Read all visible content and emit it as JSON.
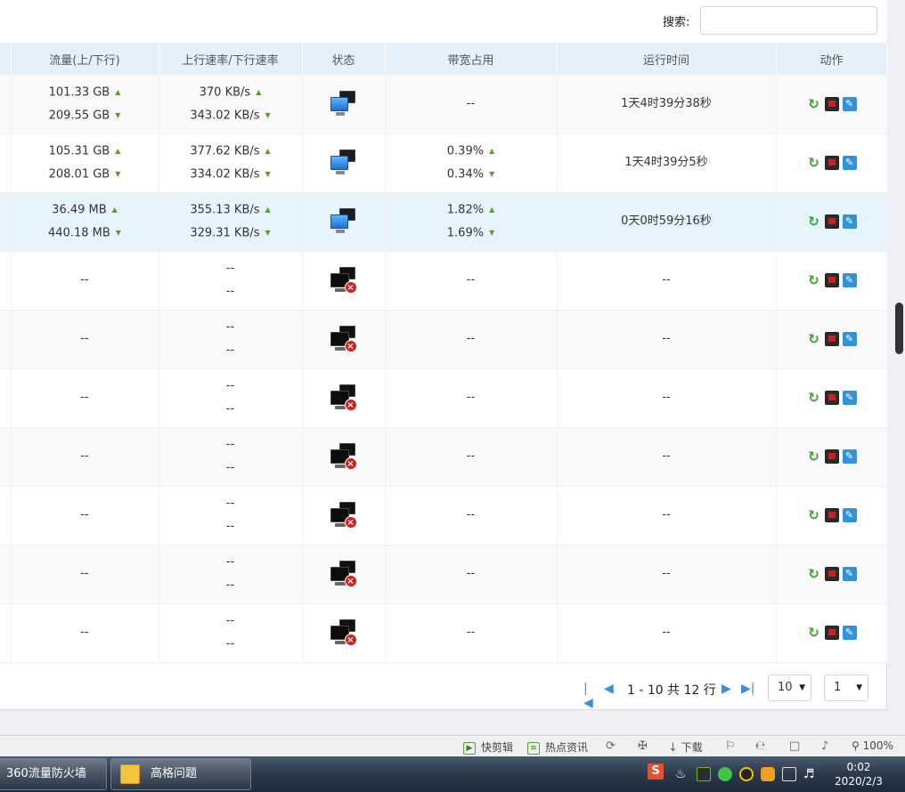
{
  "search": {
    "label": "搜索:",
    "value": ""
  },
  "columns": [
    "流量(上/下行)",
    "上行速率/下行速率",
    "状态",
    "带宽占用",
    "运行时间",
    "动作"
  ],
  "rows": [
    {
      "traffic_up": "101.33 GB",
      "traffic_down": "209.55 GB",
      "rate_up": "370 KB/s",
      "rate_down": "343.02 KB/s",
      "status": "online",
      "bw_single": "--",
      "uptime": "1天4时39分38秒",
      "selected": false
    },
    {
      "traffic_up": "105.31 GB",
      "traffic_down": "208.01 GB",
      "rate_up": "377.62 KB/s",
      "rate_down": "334.02 KB/s",
      "status": "online",
      "bw_up": "0.39%",
      "bw_down": "0.34%",
      "uptime": "1天4时39分5秒",
      "selected": false
    },
    {
      "traffic_up": "36.49 MB",
      "traffic_down": "440.18 MB",
      "rate_up": "355.13 KB/s",
      "rate_down": "329.31 KB/s",
      "status": "online",
      "bw_up": "1.82%",
      "bw_down": "1.69%",
      "uptime": "0天0时59分16秒",
      "selected": true
    },
    {
      "traffic_single": "--",
      "rate_up_plain": "--",
      "rate_down_plain": "--",
      "status": "offline",
      "bw_single": "--",
      "uptime": "--",
      "selected": false
    },
    {
      "traffic_single": "--",
      "rate_up_plain": "--",
      "rate_down_plain": "--",
      "status": "offline",
      "bw_single": "--",
      "uptime": "--",
      "selected": false
    },
    {
      "traffic_single": "--",
      "rate_up_plain": "--",
      "rate_down_plain": "--",
      "status": "offline",
      "bw_single": "--",
      "uptime": "--",
      "selected": false
    },
    {
      "traffic_single": "--",
      "rate_up_plain": "--",
      "rate_down_plain": "--",
      "status": "offline",
      "bw_single": "--",
      "uptime": "--",
      "selected": false
    },
    {
      "traffic_single": "--",
      "rate_up_plain": "--",
      "rate_down_plain": "--",
      "status": "offline",
      "bw_single": "--",
      "uptime": "--",
      "selected": false
    },
    {
      "traffic_single": "--",
      "rate_up_plain": "--",
      "rate_down_plain": "--",
      "status": "offline",
      "bw_single": "--",
      "uptime": "--",
      "selected": false
    },
    {
      "traffic_single": "--",
      "rate_up_plain": "--",
      "rate_down_plain": "--",
      "status": "offline",
      "bw_single": "--",
      "uptime": "--",
      "selected": false
    }
  ],
  "pager": {
    "info": "1 - 10 共 12 行",
    "page_size": "10",
    "page": "1"
  },
  "browser_status": {
    "kuaijianji": "快剪辑",
    "hotnews": "热点资讯",
    "download": "下载",
    "zoom": "100%"
  },
  "taskbar": {
    "app1": "360流量防火墙",
    "app2": "高格问题",
    "time": "0:02",
    "date": "2020/2/3"
  },
  "colors": {
    "accent": "#3b8ed8",
    "header_bg": "#e4f1fb",
    "selected_row": "#e6f4fd",
    "arrow_green": "#5a9e24"
  }
}
